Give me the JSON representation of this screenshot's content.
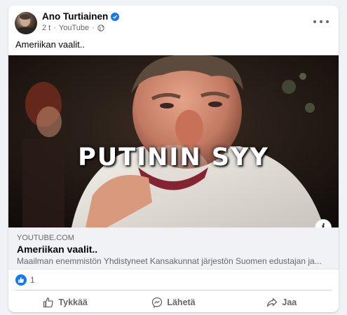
{
  "post": {
    "author": "Ano Turtiainen",
    "time": "2 t",
    "source": "YouTube",
    "separator": "·",
    "text": "Ameriikan vaalit.."
  },
  "media": {
    "overlay_text": "PUTININ SYY",
    "info_label": "i"
  },
  "link": {
    "domain": "YOUTUBE.COM",
    "title": "Ameriikan vaalit..",
    "description": "Maailman enemmistön Yhdistyneet Kansakunnat järjestön Suomen edustajan ja..."
  },
  "reactions": {
    "count": "1"
  },
  "actions": {
    "like": "Tykkää",
    "send": "Lähetä",
    "share": "Jaa"
  },
  "colors": {
    "accent": "#1877f2",
    "secondary_text": "#65676b",
    "link_bg": "#f0f2f5"
  },
  "icons": [
    "verified-badge-icon",
    "globe-icon",
    "more-options-icon",
    "info-icon",
    "like-reaction-icon",
    "thumbs-up-icon",
    "messenger-icon",
    "share-arrow-icon"
  ]
}
